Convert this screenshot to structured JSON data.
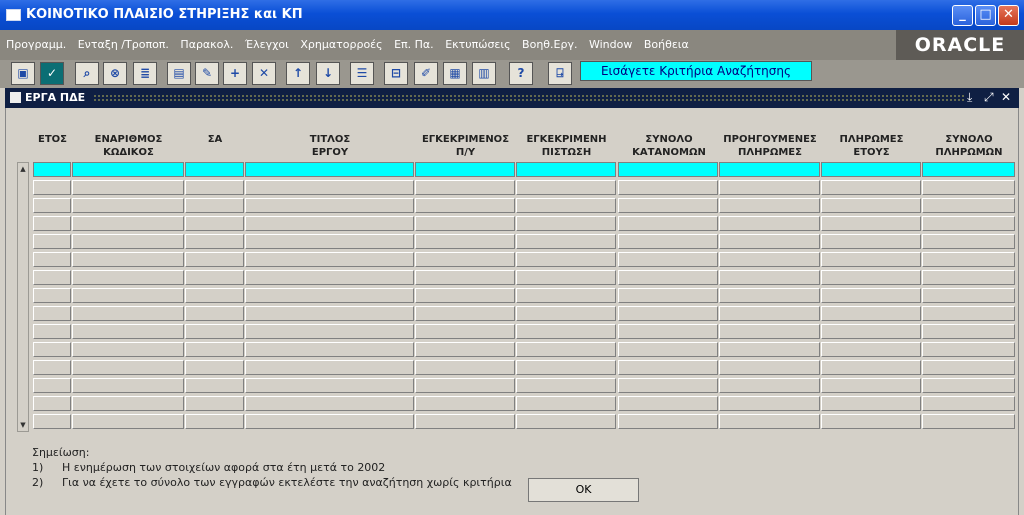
{
  "window": {
    "title": "ΚΟΙΝΟΤΙΚΟ ΠΛΑΙΣΙΟ ΣΤΗΡΙΞΗΣ και ΚΠ",
    "minimize": "_",
    "maximize": "□",
    "close": "✕"
  },
  "menu": {
    "items": [
      "Προγραμμ.",
      "Ενταξη /Τροποπ.",
      "Παρακολ.",
      "Έλεγχοι",
      "Χρηματορροές",
      "Επ. Πα.",
      "Εκτυπώσεις",
      "Βοηθ.Εργ.",
      "Window",
      "Βοήθεια"
    ],
    "brand": "ORACLE"
  },
  "toolbar": {
    "status": "Εισάγετε Κριτήρια Αναζήτησης",
    "help": "?"
  },
  "form": {
    "title": "ΕΡΓΑ ΠΔΕ",
    "columns": [
      {
        "l1": "",
        "l2": "ΕΤΟΣ"
      },
      {
        "l1": "ΕΝΑΡΙΘΜΟΣ",
        "l2": "ΚΩΔΙΚΟΣ"
      },
      {
        "l1": "",
        "l2": "ΣΑ"
      },
      {
        "l1": "ΤΙΤΛΟΣ",
        "l2": "ΕΡΓΟΥ"
      },
      {
        "l1": "ΕΓΚΕΚΡΙΜΕΝΟΣ",
        "l2": "Π/Υ"
      },
      {
        "l1": "ΕΓΚΕΚΡΙΜΕΝΗ",
        "l2": "ΠΙΣΤΩΣΗ"
      },
      {
        "l1": "ΣΥΝΟΛΟ",
        "l2": "ΚΑΤΑΝΟΜΩΝ"
      },
      {
        "l1": "ΠΡΟΗΓΟΥΜΕΝΕΣ",
        "l2": "ΠΛΗΡΩΜΕΣ"
      },
      {
        "l1": "ΠΛΗΡΩΜΕΣ",
        "l2": "ΕΤΟΥΣ"
      },
      {
        "l1": "ΣΥΝΟΛΟ",
        "l2": "ΠΛΗΡΩΜΩΝ"
      }
    ],
    "rows": 15
  },
  "notes": {
    "heading": "Σημείωση:",
    "items": [
      {
        "num": "1)",
        "text": "Η ενημέρωση των στοιχείων αφορά στα έτη μετά το 2002"
      },
      {
        "num": "2)",
        "text": "Για να έχετε το σύνολο των εγγραφών εκτελέστε την αναζήτηση χωρίς κριτήρια"
      }
    ]
  },
  "ok_button": "OK",
  "colors": {
    "cyan": "#00ffff",
    "titlebar": "#0a4fd6",
    "menubar": "#8a877f"
  }
}
